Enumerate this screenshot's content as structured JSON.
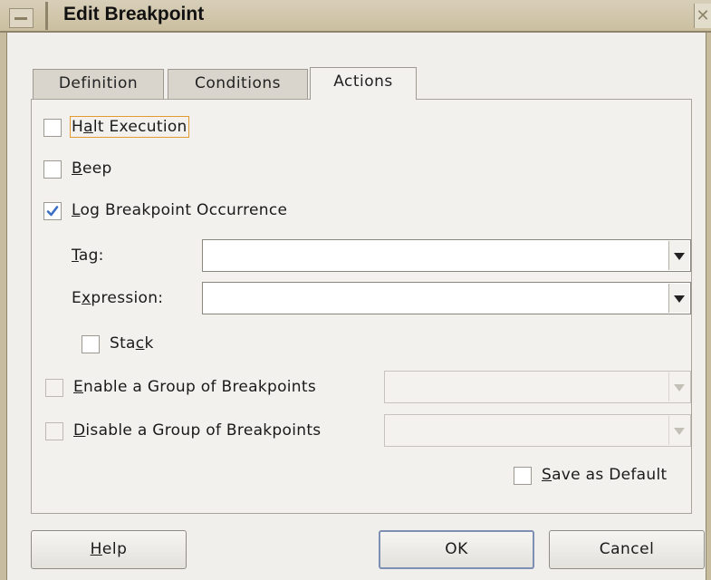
{
  "window": {
    "title": "Edit Breakpoint"
  },
  "tabs": [
    {
      "label": "Definition",
      "active": false
    },
    {
      "label": "Conditions",
      "active": false
    },
    {
      "label": "Actions",
      "active": true
    }
  ],
  "actions": {
    "halt_execution": {
      "pre": "H",
      "mn": "a",
      "post": "lt Execution",
      "checked": false
    },
    "beep": {
      "pre": "",
      "mn": "B",
      "post": "eep",
      "checked": false
    },
    "log_occurrence": {
      "pre": "",
      "mn": "L",
      "post": "og Breakpoint Occurrence",
      "checked": true
    },
    "tag": {
      "pre": "",
      "mn": "T",
      "post": "ag:",
      "value": ""
    },
    "expression": {
      "pre": "E",
      "mn": "x",
      "post": "pression:",
      "value": ""
    },
    "stack": {
      "pre": "Sta",
      "mn": "c",
      "post": "k",
      "checked": false
    },
    "enable_group": {
      "pre": "",
      "mn": "E",
      "post": "nable a Group of Breakpoints",
      "checked": false,
      "value": ""
    },
    "disable_group": {
      "pre": "",
      "mn": "D",
      "post": "isable a Group of Breakpoints",
      "checked": false,
      "value": ""
    },
    "save_default": {
      "pre": "",
      "mn": "S",
      "post": "ave as Default",
      "checked": false
    }
  },
  "buttons": {
    "help": {
      "pre": "",
      "mn": "H",
      "post": "elp"
    },
    "ok": "OK",
    "cancel": "Cancel"
  },
  "colors": {
    "title_bar": "#cbbf9f",
    "checkmark": "#3a6fc4",
    "focus": "#e59a2f",
    "default_button_border": "#7d8fb3"
  }
}
